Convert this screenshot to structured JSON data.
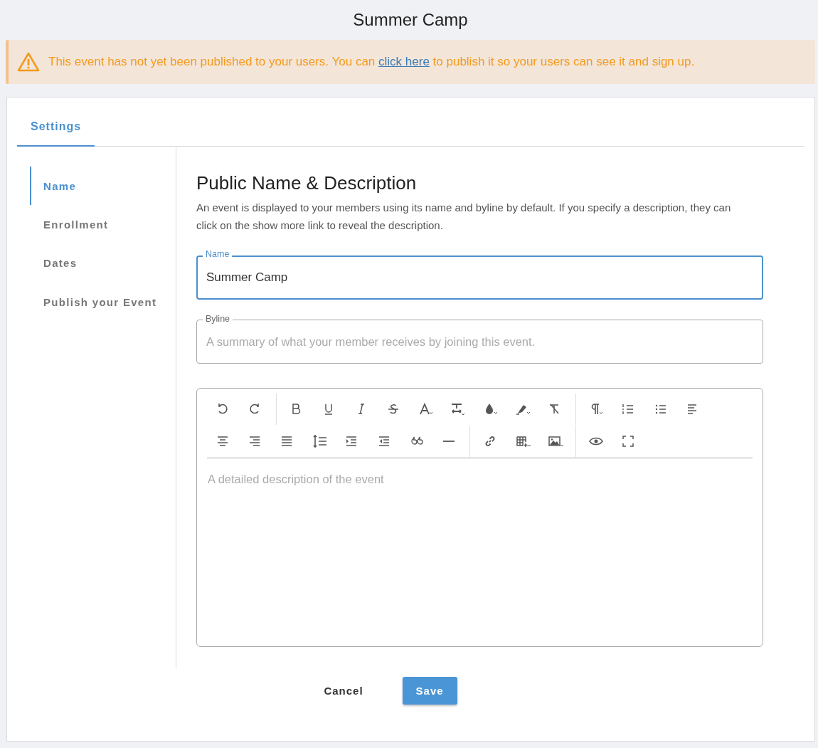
{
  "page_title": "Summer Camp",
  "alert": {
    "before": "This event has not yet been published to your users. You can ",
    "link": "click here",
    "after": " to publish it so your users can see it and sign up."
  },
  "tabs": [
    {
      "label": "Settings",
      "selected": true
    }
  ],
  "sidebar": {
    "items": [
      {
        "label": "Name",
        "selected": true
      },
      {
        "label": "Enrollment",
        "selected": false
      },
      {
        "label": "Dates",
        "selected": false
      },
      {
        "label": "Publish your Event",
        "selected": false
      }
    ]
  },
  "section": {
    "title": "Public Name & Description",
    "description": "An event is displayed to your members using its name and byline by default. If you specify a description, they can click on the show more link to reveal the description."
  },
  "fields": [
    {
      "label": "Name",
      "value": "Summer Camp",
      "focused": true
    },
    {
      "label": "Byline",
      "placeholder": "A summary of what your member receives by joining this event.",
      "focused": false
    }
  ],
  "editor": {
    "placeholder": "A detailed description of the event"
  },
  "buttons": [
    {
      "label": "Cancel",
      "kind": "text"
    },
    {
      "label": "Save",
      "kind": "primary"
    }
  ]
}
